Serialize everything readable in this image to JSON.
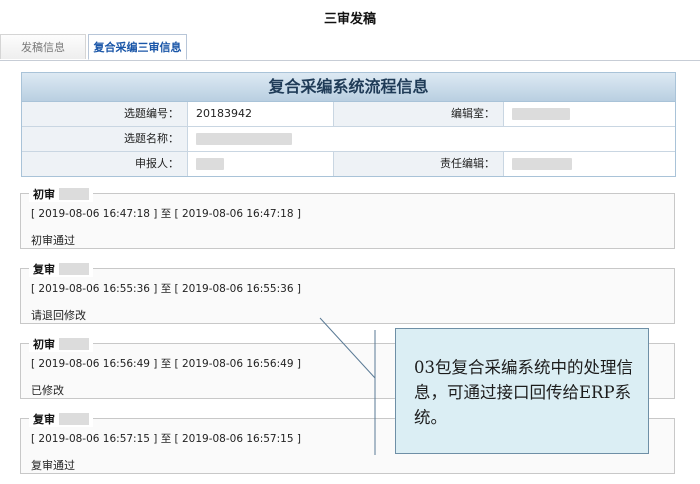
{
  "page": {
    "title": "三审发稿"
  },
  "tabs": [
    {
      "label": "发稿信息",
      "active": false
    },
    {
      "label": "复合采编三审信息",
      "active": true
    }
  ],
  "info": {
    "header": "复合采编系统流程信息",
    "topic_no_label": "选题编号：",
    "topic_no_value": "20183942",
    "editorial_office_label": "编辑室：",
    "topic_name_label": "选题名称：",
    "applicant_label": "申报人：",
    "responsible_editor_label": "责任编辑："
  },
  "logs": [
    {
      "stage": "初审",
      "time": "[ 2019-08-06 16:47:18 ] 至 [ 2019-08-06 16:47:18 ]",
      "result": "初审通过"
    },
    {
      "stage": "复审",
      "time": "[ 2019-08-06 16:55:36 ] 至 [ 2019-08-06 16:55:36 ]",
      "result": "请退回修改"
    },
    {
      "stage": "初审",
      "time": "[ 2019-08-06 16:56:49 ] 至 [ 2019-08-06 16:56:49 ]",
      "result": "已修改"
    },
    {
      "stage": "复审",
      "time": "[ 2019-08-06 16:57:15 ] 至 [ 2019-08-06 16:57:15 ]",
      "result": "复审通过"
    }
  ],
  "callout": {
    "text": "03包复合采编系统中的处理信息，可通过接口回传给ERP系统。"
  },
  "colors": {
    "tab_active": "#1a56a8",
    "header_bg": "#b9cfe1",
    "callout_bg": "#dbeef4"
  }
}
